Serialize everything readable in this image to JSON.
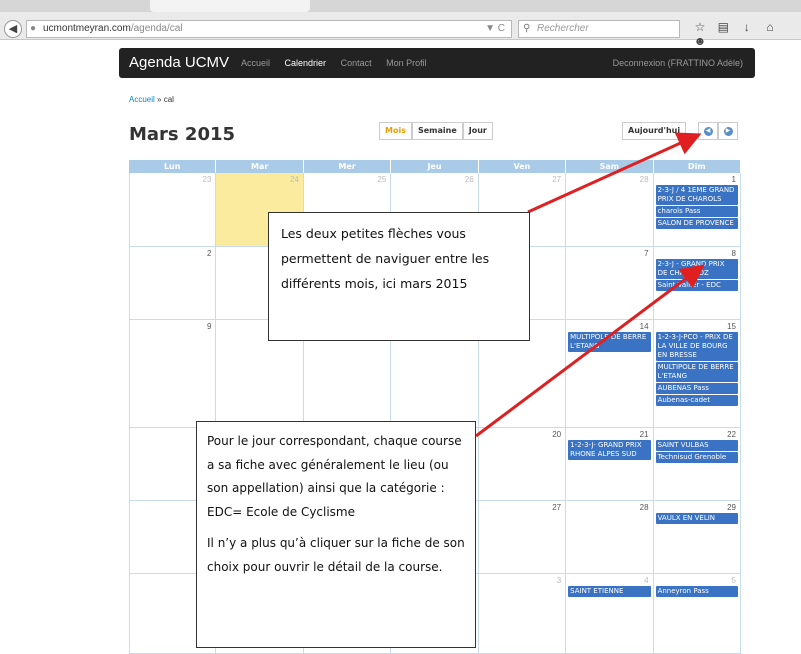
{
  "browser": {
    "url_host": "ucmontmeyran.com",
    "url_path": "/agenda/cal",
    "search_placeholder": "Rechercher"
  },
  "app": {
    "brand": "Agenda UCMV",
    "nav": [
      "Accueil",
      "Calendrier",
      "Contact",
      "Mon Profil"
    ],
    "logout": "Deconnexion (FRATTINO Adèle)"
  },
  "breadcrumb": {
    "home": "Accueil",
    "sep": "»",
    "current": "cal"
  },
  "calendar": {
    "title": "Mars 2015",
    "views": [
      "Mois",
      "Semaine",
      "Jour"
    ],
    "today_label": "Aujourd'hui",
    "weekdays": [
      "Lun",
      "Mar",
      "Mer",
      "Jeu",
      "Ven",
      "Sam",
      "Dim"
    ],
    "weeks": [
      [
        {
          "day": "23",
          "muted": true
        },
        {
          "day": "24",
          "muted": true,
          "today": true
        },
        {
          "day": "25",
          "muted": true
        },
        {
          "day": "26",
          "muted": true
        },
        {
          "day": "27",
          "muted": true
        },
        {
          "day": "28",
          "muted": true
        },
        {
          "day": "1",
          "events": [
            "2-3-J / 4 1EME GRAND PRIX DE CHAROLS",
            "charols Pass",
            "SALON DE PROVENCE"
          ]
        }
      ],
      [
        {
          "day": "2"
        },
        {
          "day": ""
        },
        {
          "day": ""
        },
        {
          "day": ""
        },
        {
          "day": ""
        },
        {
          "day": "7"
        },
        {
          "day": "8",
          "events": [
            "2-3-J - GRAND PRIX DE CHAVANOZ",
            "Saint Vallier - EDC"
          ]
        }
      ],
      [
        {
          "day": "9"
        },
        {
          "day": ""
        },
        {
          "day": ""
        },
        {
          "day": ""
        },
        {
          "day": ""
        },
        {
          "day": "14",
          "events": [
            "MULTIPOLE DE BERRE L'ETANG"
          ]
        },
        {
          "day": "15",
          "events": [
            "1-2-3-J-PCO - PRIX DE LA VILLE DE BOURG EN BRESSE",
            "MULTIPOLE DE BERRE L'ETANG",
            "AUBENAS Pass",
            "Aubenas-cadet"
          ]
        }
      ],
      [
        {
          "day": ""
        },
        {
          "day": ""
        },
        {
          "day": ""
        },
        {
          "day": ""
        },
        {
          "day": "20"
        },
        {
          "day": "21",
          "events": [
            "1-2-3-J- GRAND PRIX RHONE ALPES SUD"
          ]
        },
        {
          "day": "22",
          "events": [
            "SAINT VULBAS",
            "Technisud Grenoble"
          ]
        }
      ],
      [
        {
          "day": ""
        },
        {
          "day": ""
        },
        {
          "day": ""
        },
        {
          "day": ""
        },
        {
          "day": "27"
        },
        {
          "day": "28"
        },
        {
          "day": "29",
          "events": [
            "VAULX EN VELIN"
          ]
        }
      ],
      [
        {
          "day": ""
        },
        {
          "day": ""
        },
        {
          "day": ""
        },
        {
          "day": ""
        },
        {
          "day": "3",
          "muted": true
        },
        {
          "day": "4",
          "muted": true,
          "events": [
            "SAINT ETIENNE"
          ]
        },
        {
          "day": "5",
          "muted": true,
          "events": [
            "Anneyron Pass"
          ]
        }
      ]
    ]
  },
  "annotations": {
    "callout1": "Les deux petites flèches vous permettent de naviguer entre les différents mois, ici mars 2015",
    "callout2_p1": "Pour le jour correspondant, chaque course a sa fiche avec généralement le lieu (ou son appellation) ainsi que la catégorie : EDC= Ecole de Cyclisme",
    "callout2_p2": "Il n’y a plus qu’à cliquer sur la fiche de son choix pour ouvrir le détail de la course.",
    "arrow_color": "#e02020"
  }
}
